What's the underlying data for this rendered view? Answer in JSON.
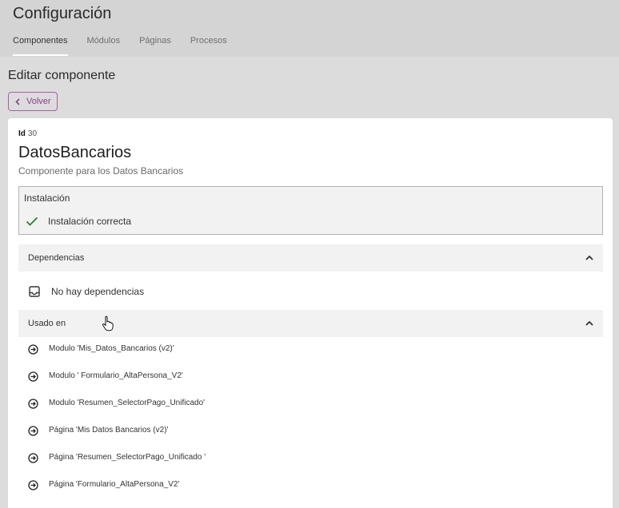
{
  "app": {
    "title": "Configuración",
    "tabs": [
      {
        "label": "Componentes",
        "active": true
      },
      {
        "label": "Módulos",
        "active": false
      },
      {
        "label": "Páginas",
        "active": false
      },
      {
        "label": "Procesos",
        "active": false
      }
    ]
  },
  "page": {
    "heading": "Editar componente",
    "back_label": "Volver",
    "back_icon": "chevron-left-icon"
  },
  "component": {
    "id_label": "Id",
    "id_value": "30",
    "name": "DatosBancarios",
    "description": "Componente para los Datos Bancarios"
  },
  "installation": {
    "title": "Instalación",
    "status_text": "Instalación correcta",
    "status_icon": "check-icon",
    "status_color": "#2e7d32"
  },
  "dependencies": {
    "title": "Dependencias",
    "expanded": true,
    "empty_text": "No hay dependencias",
    "empty_icon": "inbox-icon"
  },
  "used_in": {
    "title": "Usado en",
    "expanded": true,
    "item_icon": "arrow-circle-right-icon",
    "items": [
      "Modulo 'Mis_Datos_Bancarios (v2)'",
      "Modulo ' Formulario_AltaPersona_V2'",
      "Modulo 'Resumen_SelectorPago_Unificado'",
      "Página 'Mis Datos Bancarios (v2)'",
      "Página 'Resumen_SelectorPago_Unificado '",
      "Página 'Formulario_AltaPersona_V2'"
    ]
  },
  "colors": {
    "accent": "#8e3f8f",
    "appbar": "#d4d4d4",
    "background": "#dcdcdc",
    "success": "#2e7d32"
  }
}
